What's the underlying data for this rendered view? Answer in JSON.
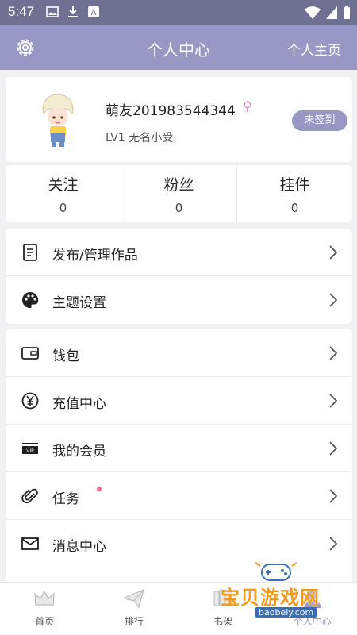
{
  "status_bar": {
    "time": "5:47"
  },
  "header": {
    "title": "个人中心",
    "right_link": "个人主页"
  },
  "profile": {
    "username": "萌友201983544344",
    "gender_symbol": "♀",
    "level": "LV1 无名小受",
    "sign_button": "未签到"
  },
  "stats": [
    {
      "label": "关注",
      "value": "0"
    },
    {
      "label": "粉丝",
      "value": "0"
    },
    {
      "label": "挂件",
      "value": "0"
    }
  ],
  "menu_group_1": [
    {
      "label": "发布/管理作品",
      "icon": "document-icon"
    },
    {
      "label": "主题设置",
      "icon": "palette-icon"
    }
  ],
  "menu_group_2": [
    {
      "label": "钱包",
      "icon": "wallet-icon"
    },
    {
      "label": "充值中心",
      "icon": "yen-icon"
    },
    {
      "label": "我的会员",
      "icon": "vip-icon"
    },
    {
      "label": "任务",
      "icon": "paperclip-icon",
      "has_badge": true
    },
    {
      "label": "消息中心",
      "icon": "mail-icon"
    }
  ],
  "bottom_nav": [
    {
      "label": "首页",
      "icon": "crown-icon"
    },
    {
      "label": "排行",
      "icon": "paper-plane-icon"
    },
    {
      "label": "书架",
      "icon": "bookshelf-icon"
    },
    {
      "label": "个人中心",
      "icon": "user-icon",
      "active": true
    }
  ],
  "watermark": {
    "text": "宝贝游戏网",
    "url": "baobeiy.com"
  },
  "colors": {
    "primary": "#9798c3",
    "status_bar": "#6f7193",
    "badge": "#ea6a98",
    "background": "#f1f1f3"
  }
}
